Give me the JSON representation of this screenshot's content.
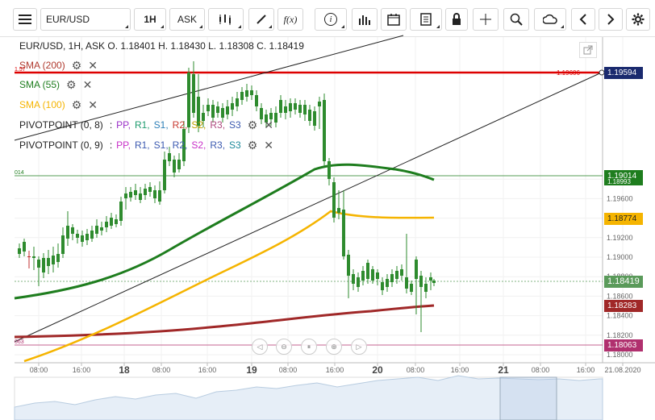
{
  "toolbar": {
    "symbol": "EUR/USD",
    "timeframe": "1H",
    "price_type": "ASK",
    "fx_label": "f(x)",
    "info_label": "i"
  },
  "legend": {
    "ohlc": "EUR/USD, 1H, ASK   O. 1.18401 H. 1.18430 L. 1.18308 C. 1.18419"
  },
  "indicators": [
    {
      "name": "SMA (200)",
      "color": "#b03a2e"
    },
    {
      "name": "SMA (55)",
      "color": "#1e7d1e"
    },
    {
      "name": "SMA (100)",
      "color": "#f5b400"
    }
  ],
  "pivots": [
    {
      "name": "PIVOTPOINT (0, 8)",
      "levels": [
        {
          "label": "PP,",
          "color": "#9b30c8"
        },
        {
          "label": "R1,",
          "color": "#1e9b6e"
        },
        {
          "label": "S1,",
          "color": "#2d7fb8"
        },
        {
          "label": "R2,",
          "color": "#c83a30"
        },
        {
          "label": "S2,",
          "color": "#c0a000"
        },
        {
          "label": "R3,",
          "color": "#b04a80"
        },
        {
          "label": "S3",
          "color": "#3c5ab0"
        }
      ]
    },
    {
      "name": "PIVOTPOINT (0, 9)",
      "levels": [
        {
          "label": "PP,",
          "color": "#c830c8"
        },
        {
          "label": "R1,",
          "color": "#3c5ab0"
        },
        {
          "label": "S1,",
          "color": "#3c5ab0"
        },
        {
          "label": "R2,",
          "color": "#3c5ab0"
        },
        {
          "label": "S2,",
          "color": "#c830c8"
        },
        {
          "label": "R3,",
          "color": "#3c5ab0"
        },
        {
          "label": "S3",
          "color": "#1e8a9b"
        }
      ]
    }
  ],
  "price_axis": {
    "ticks": [
      "1.19800",
      "1.19600",
      "1.19400",
      "1.19200",
      "1.19000",
      "1.18800",
      "1.18600",
      "1.18400",
      "1.18200",
      "1.18000"
    ],
    "labels": [
      {
        "text": "1.19594",
        "bg": "#1a2a6e",
        "fg": "#ffffff"
      },
      {
        "text": "1.19014",
        "bg": "#1e7d1e",
        "fg": "#ffffff"
      },
      {
        "text": "1.18993",
        "bg": "#1e7d1e",
        "fg": "#ffffff"
      },
      {
        "text": "1.18774",
        "bg": "#f5b400",
        "fg": "#222222"
      },
      {
        "text": "1.18419",
        "bg": "#5a9a5a",
        "fg": "#ffffff"
      },
      {
        "text": "1.18283",
        "bg": "#a02828",
        "fg": "#ffffff"
      },
      {
        "text": "1.18063",
        "bg": "#b0306e",
        "fg": "#ffffff"
      }
    ],
    "red_line_label": "1.19606"
  },
  "time_axis": {
    "labels": [
      "08:00",
      "16:00",
      "18",
      "08:00",
      "16:00",
      "19",
      "08:00",
      "16:00",
      "20",
      "08:00",
      "16:00",
      "21",
      "08:00",
      "16:00",
      "21.08.2020"
    ]
  },
  "chart_data": {
    "type": "candlestick",
    "symbol": "EUR/USD",
    "interval": "1H",
    "ylim": [
      1.179,
      1.1985
    ],
    "ohlc_last": {
      "open": 1.18401,
      "high": 1.1843,
      "low": 1.18308,
      "close": 1.18419
    },
    "sma_200_last": 1.18283,
    "sma_55_last": 1.18993,
    "sma_100_last": 1.18774,
    "horizontal_lines": [
      1.19594,
      1.19014,
      1.18063
    ]
  },
  "edge_marks": {
    "top": "1.57",
    "mid": "014",
    "low": "063"
  }
}
